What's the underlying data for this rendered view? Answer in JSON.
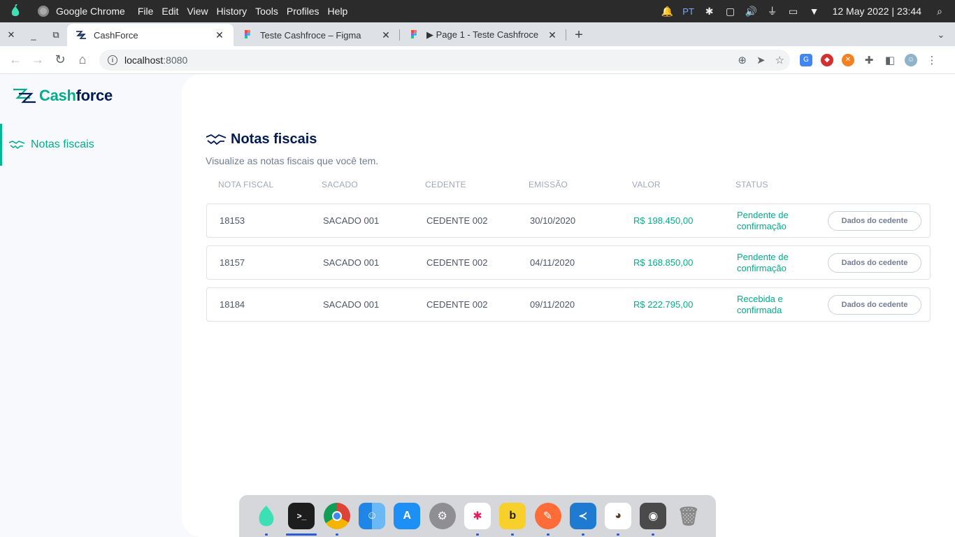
{
  "menubar": {
    "app_name": "Google Chrome",
    "menu_items": [
      "File",
      "Edit",
      "View",
      "History",
      "Tools",
      "Profiles",
      "Help"
    ],
    "lang": "PT",
    "clock": "12 May 2022 | 23:44"
  },
  "tabs": [
    {
      "title": "CashForce",
      "active": true
    },
    {
      "title": "Teste Cashfroce – Figma",
      "active": false
    },
    {
      "title": "▶ Page 1 - Teste Cashfroce",
      "active": false
    }
  ],
  "toolbar": {
    "url_host": "localhost",
    "url_port": ":8080"
  },
  "sidebar": {
    "logo_cash": "Cash",
    "logo_force": "force",
    "nav_label": "Notas fiscais"
  },
  "main": {
    "title": "Notas fiscais",
    "subtitle": "Visualize as notas fiscais que você tem.",
    "columns": [
      "NOTA FISCAL",
      "SACADO",
      "CEDENTE",
      "EMISSÃO",
      "VALOR",
      "STATUS"
    ],
    "rows": [
      {
        "nota": "18153",
        "sacado": "SACADO 001",
        "cedente": "CEDENTE 002",
        "emissao": "30/10/2020",
        "valor": "R$ 198.450,00",
        "status_1": "Pendente de",
        "status_2": "confirmação",
        "button": "Dados do cedente"
      },
      {
        "nota": "18157",
        "sacado": "SACADO 001",
        "cedente": "CEDENTE 002",
        "emissao": "04/11/2020",
        "valor": "R$ 168.850,00",
        "status_1": "Pendente de",
        "status_2": "confirmação",
        "button": "Dados do cedente"
      },
      {
        "nota": "18184",
        "sacado": "SACADO 001",
        "cedente": "CEDENTE 002",
        "emissao": "09/11/2020",
        "valor": "R$ 222.795,00",
        "status_1": "Recebida e",
        "status_2": "confirmada",
        "button": "Dados do cedente"
      }
    ]
  },
  "colors": {
    "accent": "#00ad8c",
    "navy": "#021b51"
  }
}
